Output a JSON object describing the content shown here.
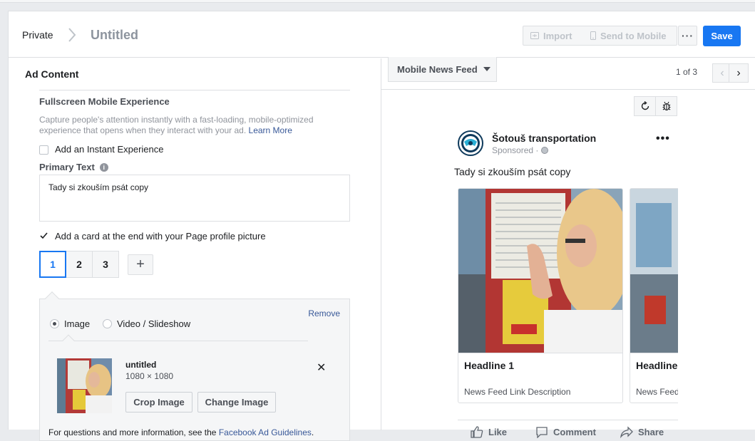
{
  "header": {
    "breadcrumb_private": "Private",
    "title": "Untitled",
    "import_label": "Import",
    "send_to_mobile_label": "Send to Mobile",
    "more_label": "···",
    "save_label": "Save"
  },
  "ad_content": {
    "section_title": "Ad Content",
    "fullscreen_title": "Fullscreen Mobile Experience",
    "fullscreen_desc": "Capture people's attention instantly with a fast-loading, mobile-optimized experience that opens when they interact with your ad.",
    "learn_more": "Learn More",
    "instant_experience_label": "Add an Instant Experience",
    "instant_experience_checked": false,
    "primary_text_label": "Primary Text",
    "primary_text_info": "i",
    "primary_text_value": "Tady si zkouším psát copy",
    "end_card_label": "Add a card at the end with your Page profile picture",
    "end_card_checked": true,
    "card_tabs": [
      "1",
      "2",
      "3"
    ],
    "active_card": "1",
    "add_card_label": "+",
    "remove_label": "Remove",
    "media_options": [
      {
        "label": "Image",
        "selected": true
      },
      {
        "label": "Video / Slideshow",
        "selected": false
      }
    ],
    "image": {
      "name": "untitled",
      "size": "1080 × 1080",
      "close": "✕"
    },
    "crop_label": "Crop Image",
    "change_label": "Change Image",
    "guidelines_prefix": "For questions and more information, see the",
    "guidelines_link": "Facebook Ad Guidelines",
    "guidelines_suffix": "."
  },
  "preview": {
    "placement": "Mobile News Feed",
    "pager": "1 of 3",
    "prev": "‹",
    "next": "›",
    "page_name": "Šotouš transportation",
    "sponsored": "Sponsored ·",
    "more": "•••",
    "post_text": "Tady si zkouším psát copy",
    "cards": [
      {
        "headline": "Headline 1",
        "description": "News Feed Link Description"
      },
      {
        "headline": "Headline",
        "description": "News Feed"
      }
    ],
    "actions": {
      "like": "Like",
      "comment": "Comment",
      "share": "Share"
    }
  },
  "colors": {
    "accent": "#1877f2",
    "link": "#385898",
    "border": "#dddfe2",
    "muted": "#90949c"
  }
}
